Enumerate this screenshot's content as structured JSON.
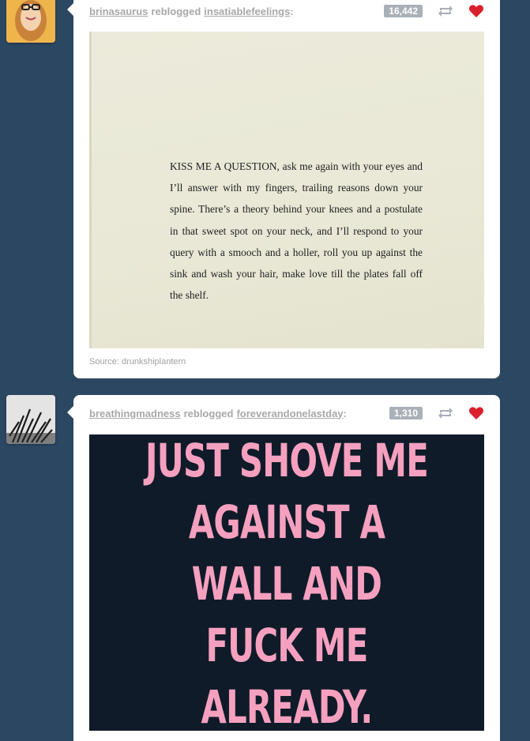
{
  "posts": [
    {
      "blogger": "brinasaurus",
      "action": "reblogged",
      "source_blog": "insatiablefeelings",
      "separator": ":",
      "notes": "16,442",
      "photo_text": "KISS ME A QUESTION, ask me again with your eyes and I’ll answer with my fingers, trailing reasons down your spine. There’s a theory behind your knees and a postulate in that sweet spot on your neck, and I’ll respond to your query with a smooch and a holler, roll you up against the sink and wash your hair, make love till the plates fall off the shelf.",
      "source_label": "Source: drunkshiplantern"
    },
    {
      "blogger": "breathingmadness",
      "action": "reblogged",
      "source_blog": "foreverandonelastday",
      "separator": ":",
      "notes": "1,310",
      "photo_text": "JUST SHOVE ME AGAINST A WALL AND FUCK ME ALREADY."
    }
  ],
  "icons": {
    "reblog": "reblog-icon",
    "like": "heart-icon"
  },
  "colors": {
    "dashboard_background": "#2c4762",
    "like_red": "#d9202c",
    "notes_badge": "#a9b0b8",
    "poster_pink": "#f6a0bf",
    "poster_background": "#0f1b28"
  }
}
